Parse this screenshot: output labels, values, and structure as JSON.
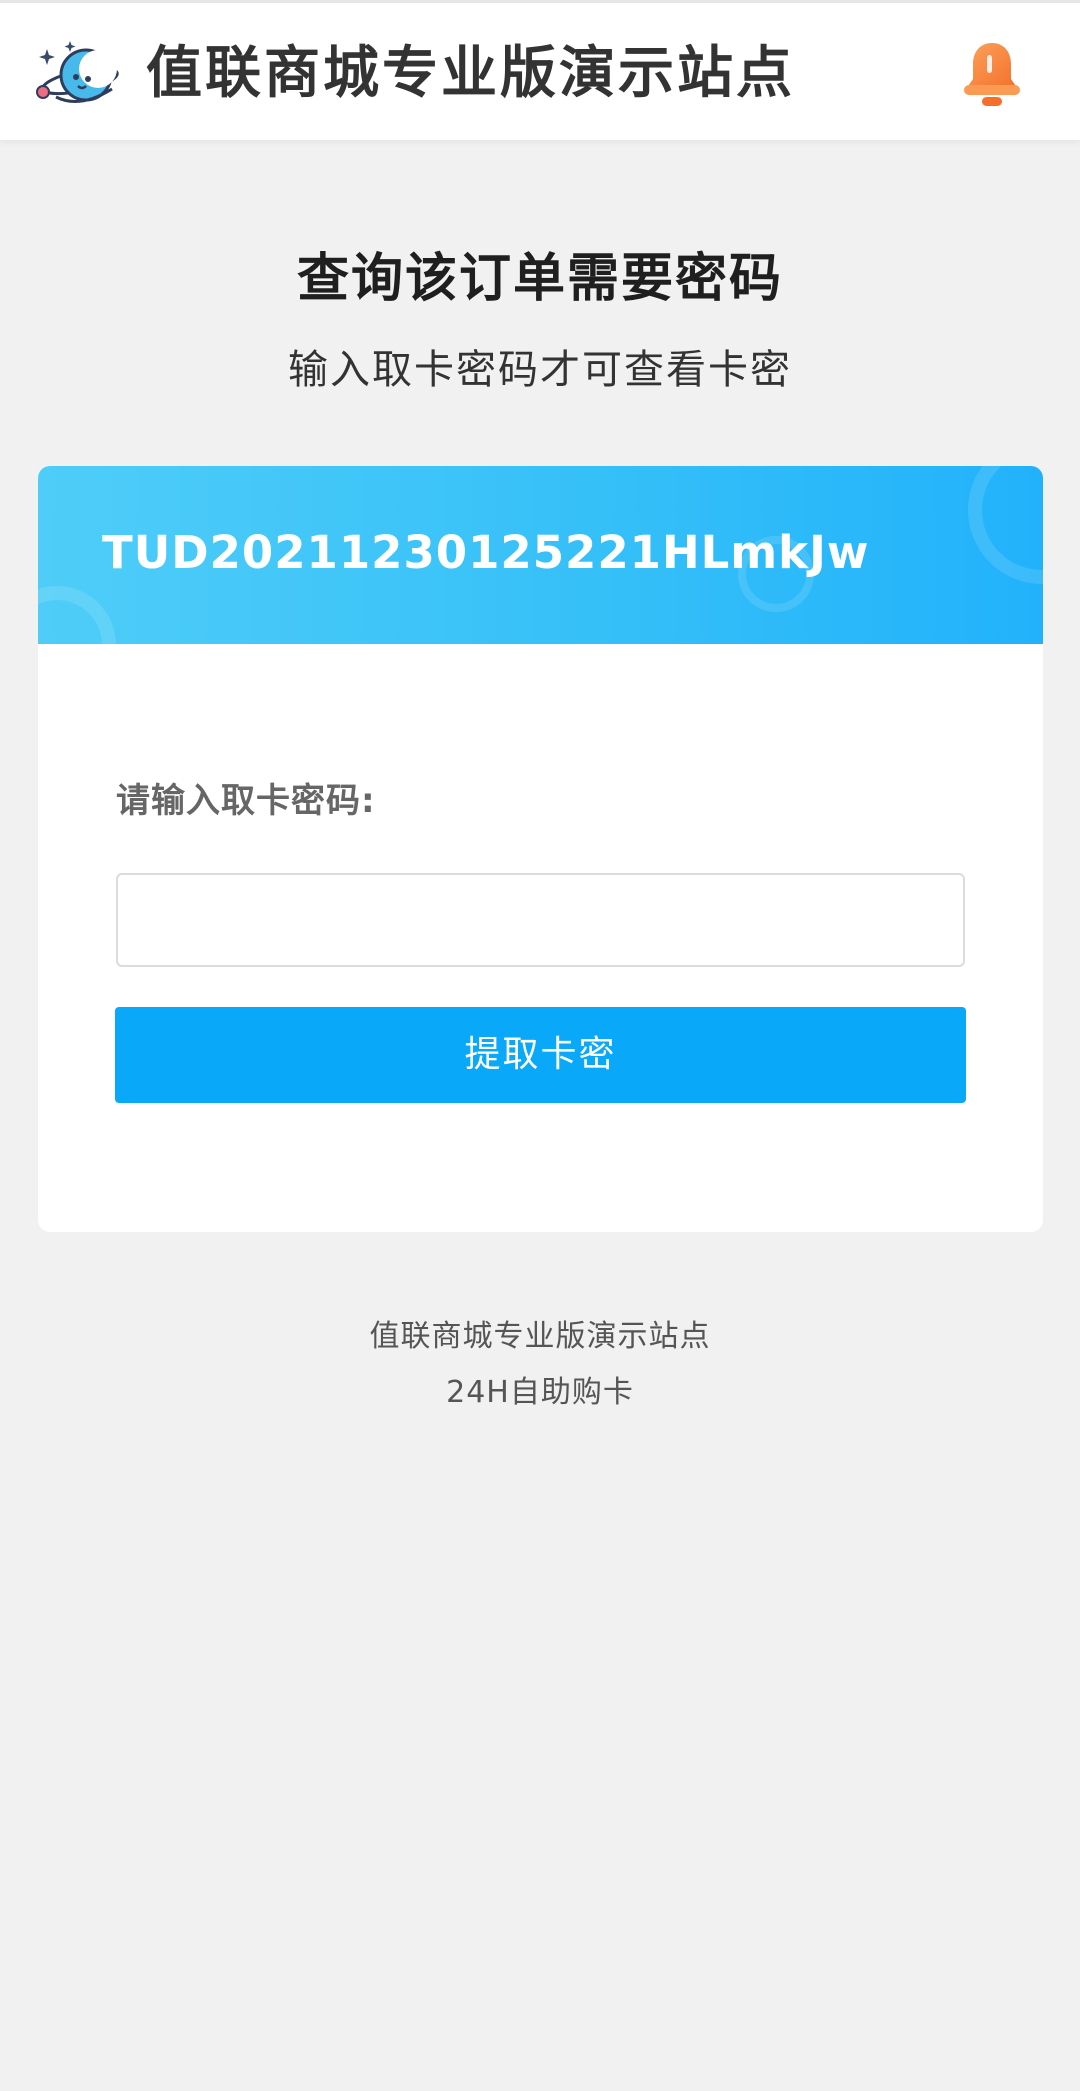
{
  "header": {
    "site_title": "值联商城专业版演示站点",
    "logo_icon": "crescent-moon-logo-icon",
    "notification_icon": "bell-icon"
  },
  "main": {
    "heading": "查询该订单需要密码",
    "subtitle": "输入取卡密码才可查看卡密"
  },
  "card": {
    "order_id": "TUD20211230125221HLmkJw",
    "field_label": "请输入取卡密码:",
    "password_value": "",
    "password_placeholder": "",
    "submit_label": "提取卡密"
  },
  "footer": {
    "site_name": "值联商城专业版演示站点",
    "slogan": "24H自助购卡"
  },
  "colors": {
    "page_background": "#f1f1f2",
    "card_header_gradient_start": "#4fcdf8",
    "card_header_gradient_end": "#22b2fb",
    "button": "#0aa8f8",
    "bell": "#f7873a"
  }
}
